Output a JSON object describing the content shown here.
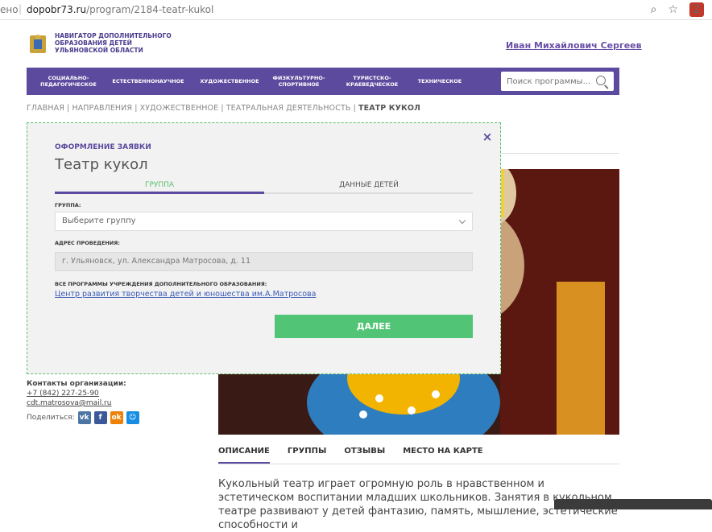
{
  "browser": {
    "prefix": "ено",
    "url_host": "dopobr73.ru",
    "url_path": "/program/2184-teatr-kukol",
    "extension_badge": "2"
  },
  "header": {
    "logo_text": "НАВИГАТОР ДОПОЛНИТЕЛЬНОГО ОБРАЗОВАНИЯ ДЕТЕЙ УЛЬЯНОВСКОЙ ОБЛАСТИ",
    "user_name": "Иван Михайлович Сергеев"
  },
  "nav": {
    "items": [
      "СОЦИАЛЬНО-ПЕДАГОГИЧЕСКОЕ",
      "ЕСТЕСТВЕННОНАУЧНОЕ",
      "ХУДОЖЕСТВЕННОЕ",
      "ФИЗКУЛЬТУРНО-СПОРТИВНОЕ",
      "ТУРИСТСКО-КРАЕВЕДЧЕСКОЕ",
      "ТЕХНИЧЕСКОЕ"
    ],
    "search_placeholder": "Поиск программы..."
  },
  "breadcrumb": {
    "items": [
      "ГЛАВНАЯ",
      "НАПРАВЛЕНИЯ",
      "ХУДОЖЕСТВЕННОЕ",
      "ТЕАТРАЛЬНАЯ ДЕЯТЕЛЬНОСТЬ"
    ],
    "current": "ТЕАТР КУКОЛ"
  },
  "modal": {
    "subtitle": "ОФОРМЛЕНИЕ ЗАЯВКИ",
    "title": "Театр кукол",
    "step1": "ГРУППА",
    "step2": "ДАННЫЕ ДЕТЕЙ",
    "group_label": "ГРУППА:",
    "group_placeholder": "Выберите группу",
    "address_label": "АДРЕС ПРОВЕДЕНИЯ:",
    "address_value": "г. Ульяновск, ул. Александра Матросова, д. 11",
    "org_label": "ВСЕ ПРОГРАММЫ УЧРЕЖДЕНИЯ ДОПОЛНИТЕЛЬНОГО ОБРАЗОВАНИЯ:",
    "org_link": "Центр развития творчества детей и юношества им.А.Матросова",
    "next_button": "ДАЛЕЕ",
    "close_icon": "×"
  },
  "contacts": {
    "title": "Контакты организации:",
    "phone": "+7 (842) 227-25-90",
    "email": "cdt.matrosova@mail.ru"
  },
  "share": {
    "label": "Поделиться:"
  },
  "tabs": [
    "ОПИСАНИЕ",
    "ГРУППЫ",
    "ОТЗЫВЫ",
    "МЕСТО НА КАРТЕ"
  ],
  "description": "Кукольный театр играет огромную роль в нравственном и эстетическом воспитании младших школьников. Занятия в кукольном театре развивают у детей фантазию, память, мышление, эстетические способности и",
  "colors": {
    "brand": "#5b4a9e",
    "accent_green": "#52c475",
    "link": "#3a5bb7"
  }
}
